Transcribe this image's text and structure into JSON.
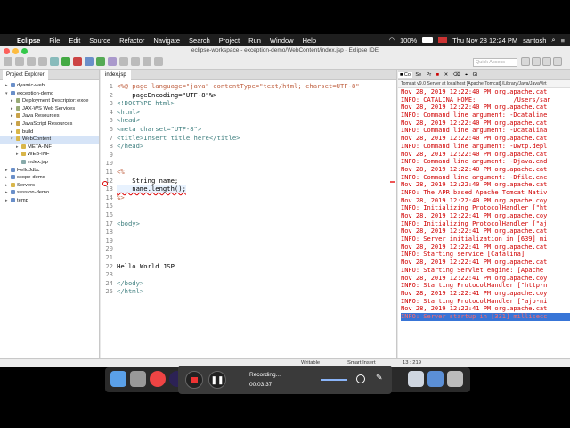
{
  "menubar": {
    "app": "Eclipse",
    "items": [
      "File",
      "Edit",
      "Source",
      "Refactor",
      "Navigate",
      "Search",
      "Project",
      "Run",
      "Window",
      "Help"
    ],
    "battery": "100%",
    "datetime": "Thu Nov 28  12:24 PM",
    "user": "santosh"
  },
  "window": {
    "title": "eclipse-workspace - exception-demo/WebContent/index.jsp - Eclipse IDE",
    "quick_access": "Quick Access"
  },
  "explorer": {
    "tab": "Project Explorer",
    "items": [
      {
        "label": "dyamic-web",
        "indent": 1,
        "tw": "▸",
        "color": "#6a8fc9"
      },
      {
        "label": "exception-demo",
        "indent": 1,
        "tw": "▾",
        "color": "#6a8fc9"
      },
      {
        "label": "Deployment Descriptor: exce",
        "indent": 2,
        "tw": "▸",
        "color": "#9a7"
      },
      {
        "label": "JAX-WS Web Services",
        "indent": 2,
        "tw": "▸",
        "color": "#9a7"
      },
      {
        "label": "Java Resources",
        "indent": 2,
        "tw": "▸",
        "color": "#c9a34a"
      },
      {
        "label": "JavaScript Resources",
        "indent": 2,
        "tw": "▸",
        "color": "#c9a34a"
      },
      {
        "label": "build",
        "indent": 2,
        "tw": "▸",
        "color": "#d9b64a"
      },
      {
        "label": "WebContent",
        "indent": 2,
        "tw": "▾",
        "color": "#d9b64a"
      },
      {
        "label": "META-INF",
        "indent": 3,
        "tw": "▸",
        "color": "#d9b64a"
      },
      {
        "label": "WEB-INF",
        "indent": 3,
        "tw": "▸",
        "color": "#d9b64a"
      },
      {
        "label": "index.jsp",
        "indent": 3,
        "tw": "",
        "color": "#8aa"
      },
      {
        "label": "HelloJdbc",
        "indent": 1,
        "tw": "▸",
        "color": "#6a8fc9"
      },
      {
        "label": "scope-demo",
        "indent": 1,
        "tw": "▸",
        "color": "#6a8fc9"
      },
      {
        "label": "Servers",
        "indent": 1,
        "tw": "▸",
        "color": "#d9b64a"
      },
      {
        "label": "session-demo",
        "indent": 1,
        "tw": "▸",
        "color": "#6a8fc9"
      },
      {
        "label": "temp",
        "indent": 1,
        "tw": "▸",
        "color": "#6a8fc9"
      }
    ]
  },
  "editor": {
    "tab": "index.jsp",
    "lines": [
      {
        "n": "1",
        "t": "<%@ page language=\"java\" contentType=\"text/html; charset=UTF-8\""
      },
      {
        "n": "2",
        "t": "    pageEncoding=\"UTF-8\"%>"
      },
      {
        "n": "3",
        "t": "<!DOCTYPE html>"
      },
      {
        "n": "4",
        "t": "<html>"
      },
      {
        "n": "5",
        "t": "<head>"
      },
      {
        "n": "6",
        "t": "<meta charset=\"UTF-8\">"
      },
      {
        "n": "7",
        "t": "<title>Insert title here</title>"
      },
      {
        "n": "8",
        "t": "</head>"
      },
      {
        "n": "9",
        "t": ""
      },
      {
        "n": "10",
        "t": ""
      },
      {
        "n": "11",
        "t": "<%"
      },
      {
        "n": "12",
        "t": "    String name;"
      },
      {
        "n": "13",
        "t": "    name.length();"
      },
      {
        "n": "14",
        "t": "%>"
      },
      {
        "n": "15",
        "t": ""
      },
      {
        "n": "16",
        "t": ""
      },
      {
        "n": "17",
        "t": "<body>"
      },
      {
        "n": "18",
        "t": ""
      },
      {
        "n": "19",
        "t": ""
      },
      {
        "n": "20",
        "t": ""
      },
      {
        "n": "21",
        "t": ""
      },
      {
        "n": "22",
        "t": "Hello World JSP"
      },
      {
        "n": "23",
        "t": ""
      },
      {
        "n": "24",
        "t": "</body>"
      },
      {
        "n": "25",
        "t": "</html>"
      }
    ]
  },
  "status": {
    "mode": "Writable",
    "insert": "Smart Insert",
    "position": "13 : 219"
  },
  "console": {
    "header": "Tomcat v9.0 Server at localhost [Apache Tomcat] /Library/Java/JavaVirt",
    "lines": [
      "Nov 28, 2019 12:22:40 PM org.apache.cat",
      "INFO: CATALINA_HOME:          /Users/san",
      "Nov 28, 2019 12:22:40 PM org.apache.cat",
      "INFO: Command line argument: -Dcataline",
      "Nov 28, 2019 12:22:40 PM org.apache.cat",
      "INFO: Command line argument: -Dcatalina",
      "Nov 28, 2019 12:22:40 PM org.apache.cat",
      "INFO: Command line argument: -Dwtp.depl",
      "Nov 28, 2019 12:22:40 PM org.apache.cat",
      "INFO: Command line argument: -Djava.end",
      "Nov 28, 2019 12:22:40 PM org.apache.cat",
      "INFO: Command line argument: -Dfile.enc",
      "Nov 28, 2019 12:22:40 PM org.apache.cat",
      "INFO: The APR based Apache Tomcat Nativ",
      "Nov 28, 2019 12:22:40 PM org.apache.coy",
      "INFO: Initializing ProtocolHandler [\"ht",
      "Nov 28, 2019 12:22:41 PM org.apache.coy",
      "INFO: Initializing ProtocolHandler [\"aj",
      "Nov 28, 2019 12:22:41 PM org.apache.cat",
      "INFO: Server initialization in [639] mi",
      "Nov 28, 2019 12:22:41 PM org.apache.cat",
      "INFO: Starting service [Catalina]",
      "Nov 28, 2019 12:22:41 PM org.apache.cat",
      "INFO: Starting Servlet engine: [Apache",
      "Nov 28, 2019 12:22:41 PM org.apache.coy",
      "INFO: Starting ProtocolHandler [\"http-n",
      "Nov 28, 2019 12:22:41 PM org.apache.coy",
      "INFO: Starting ProtocolHandler [\"ajp-ni",
      "Nov 28, 2019 12:22:41 PM org.apache.cat",
      "INFO: Server startup in [331] millisecc"
    ]
  },
  "recording": {
    "label": "Recording...",
    "time": "00:03:37"
  }
}
